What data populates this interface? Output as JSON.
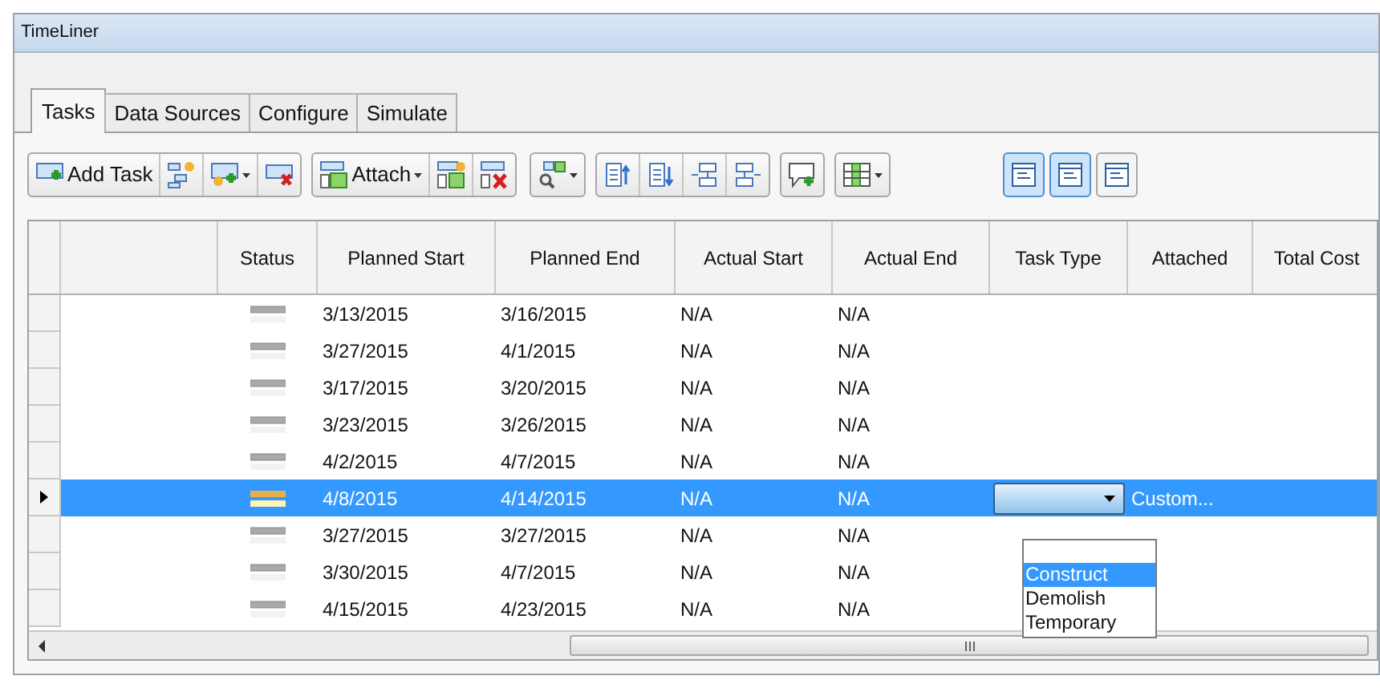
{
  "window": {
    "title": "TimeLiner"
  },
  "tabs": [
    {
      "label": "Tasks",
      "selected": true
    },
    {
      "label": "Data Sources",
      "selected": false
    },
    {
      "label": "Configure",
      "selected": false
    },
    {
      "label": "Simulate",
      "selected": false
    }
  ],
  "toolbar": [
    [
      {
        "kind": "button",
        "label": "Add Task"
      },
      {
        "kind": "button"
      },
      {
        "kind": "dropdown"
      },
      {
        "kind": "button"
      }
    ],
    [
      {
        "kind": "dropdown",
        "label": "Attach"
      },
      {
        "kind": "button"
      },
      {
        "kind": "button"
      }
    ],
    [
      {
        "kind": "dropdown"
      }
    ],
    [
      {
        "kind": "button"
      },
      {
        "kind": "button"
      },
      {
        "kind": "button"
      },
      {
        "kind": "button"
      }
    ],
    [
      {
        "kind": "button"
      }
    ],
    [
      {
        "kind": "dropdown"
      }
    ]
  ],
  "view_toggles": [
    {
      "selected": true
    },
    {
      "selected": true
    },
    {
      "selected": false
    }
  ],
  "table": {
    "columns": [
      "Status",
      "Planned Start",
      "Planned End",
      "Actual Start",
      "Actual End",
      "Task Type",
      "Attached",
      "Total Cost"
    ],
    "rows": [
      {
        "selected": false,
        "planned_start": "3/13/2015",
        "planned_end": "3/16/2015",
        "actual_start": "N/A",
        "actual_end": "N/A"
      },
      {
        "selected": false,
        "planned_start": "3/27/2015",
        "planned_end": "4/1/2015",
        "actual_start": "N/A",
        "actual_end": "N/A"
      },
      {
        "selected": false,
        "planned_start": "3/17/2015",
        "planned_end": "3/20/2015",
        "actual_start": "N/A",
        "actual_end": "N/A"
      },
      {
        "selected": false,
        "planned_start": "3/23/2015",
        "planned_end": "3/26/2015",
        "actual_start": "N/A",
        "actual_end": "N/A"
      },
      {
        "selected": false,
        "planned_start": "4/2/2015",
        "planned_end": "4/7/2015",
        "actual_start": "N/A",
        "actual_end": "N/A"
      },
      {
        "selected": true,
        "planned_start": "4/8/2015",
        "planned_end": "4/14/2015",
        "actual_start": "N/A",
        "actual_end": "N/A",
        "attached": "Custom..."
      },
      {
        "selected": false,
        "planned_start": "3/27/2015",
        "planned_end": "3/27/2015",
        "actual_start": "N/A",
        "actual_end": "N/A"
      },
      {
        "selected": false,
        "planned_start": "3/30/2015",
        "planned_end": "4/7/2015",
        "actual_start": "N/A",
        "actual_end": "N/A"
      },
      {
        "selected": false,
        "planned_start": "4/15/2015",
        "planned_end": "4/23/2015",
        "actual_start": "N/A",
        "actual_end": "N/A"
      }
    ]
  },
  "task_type_dropdown": {
    "options": [
      {
        "label": "Construct",
        "selected": true
      },
      {
        "label": "Demolish",
        "selected": false
      },
      {
        "label": "Temporary",
        "selected": false
      }
    ]
  }
}
